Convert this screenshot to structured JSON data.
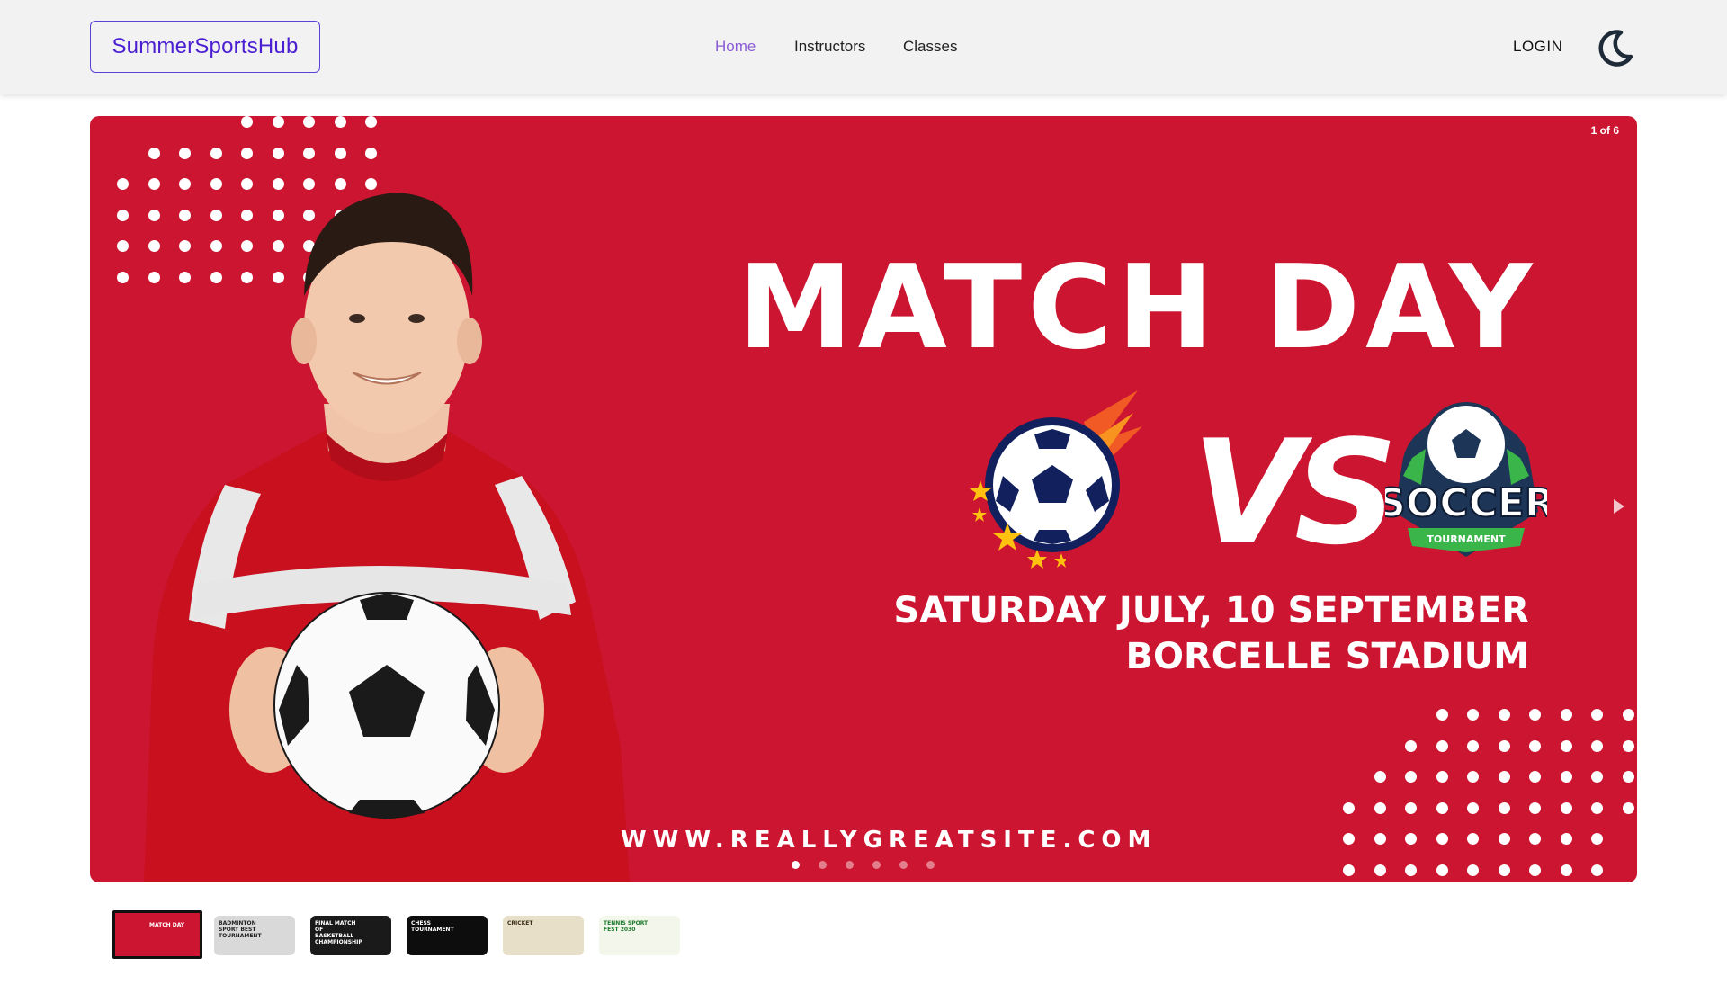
{
  "navbar": {
    "brand": "SummerSportsHub",
    "links": [
      "Home",
      "Instructors",
      "Classes"
    ],
    "active_link": "Home",
    "login": "LOGIN",
    "theme_icon": "moon-icon"
  },
  "carousel": {
    "counter": "1 of 6",
    "current_index": 1,
    "total": 6,
    "slide": {
      "headline": "MATCH DAY",
      "vs": "VS",
      "logo_text": "SOCCER",
      "logo_ribbon": "TOURNAMENT",
      "date": "SATURDAY JULY, 10 SEPTEMBER",
      "venue": "BORCELLE STADIUM",
      "website": "WWW.REALLYGREATSITE.COM",
      "background_color": "#cc1530"
    },
    "next_icon": "chevron-right-icon"
  },
  "thumbnails": [
    {
      "label": "MATCH DAY",
      "bg": "#cc1530",
      "text_color": "#ffffff"
    },
    {
      "label": "BADMINTON SPORT BEST TOURNAMENT",
      "bg": "#d9d9d9",
      "text_color": "#222222"
    },
    {
      "label": "FINAL MATCH OF BASKETBALL CHAMPIONSHIP",
      "bg": "#1a1a1a",
      "text_color": "#ffffff"
    },
    {
      "label": "CHESS TOURNAMENT",
      "bg": "#0d0d0d",
      "text_color": "#ffffff"
    },
    {
      "label": "CRICKET",
      "bg": "#e8dfc8",
      "text_color": "#3b2f1a"
    },
    {
      "label": "TENNIS SPORT FEST 2030",
      "bg": "#f3f6ea",
      "text_color": "#1d7a2b"
    }
  ]
}
